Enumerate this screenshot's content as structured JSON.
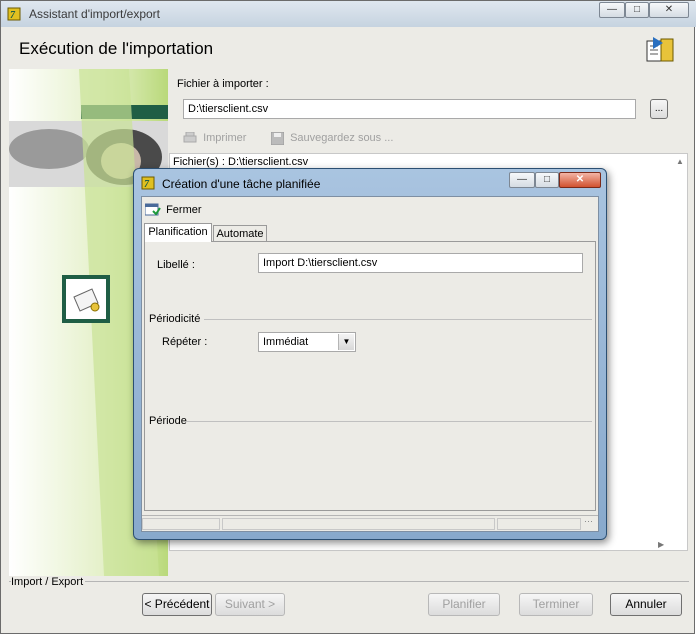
{
  "outer_window": {
    "title": "Assistant d'import/export",
    "page_title": "Exécution de l'importation",
    "file_label": "Fichier à importer :",
    "file_value": "D:\\tiersclient.csv",
    "browse_label": "...",
    "print_label": "Imprimer",
    "save_as_label": "Sauvegardez sous ...",
    "log_line": "Fichier(s) : D:\\tiersclient.csv",
    "status_text": "Import / Export",
    "buttons": {
      "previous": "< Précédent",
      "next": "Suivant >",
      "plan": "Planifier",
      "finish": "Terminer",
      "cancel": "Annuler"
    }
  },
  "dialog": {
    "title": "Création d'une tâche planifiée",
    "close_label": "Fermer",
    "tabs": [
      "Planification",
      "Automate"
    ],
    "libelle_label": "Libellé :",
    "libelle_value": "Import D:\\tiersclient.csv",
    "periodicite_label": "Périodicité",
    "repeter_label": "Répéter :",
    "repeter_value": "Immédiat",
    "periode_label": "Période"
  },
  "colors": {
    "accent_green": "#1f5e45",
    "light_green": "#b9d97a",
    "title_bar": "#c6d3e0",
    "dialog_frame": "#88a9cc",
    "window_bg": "#ecebe6"
  }
}
